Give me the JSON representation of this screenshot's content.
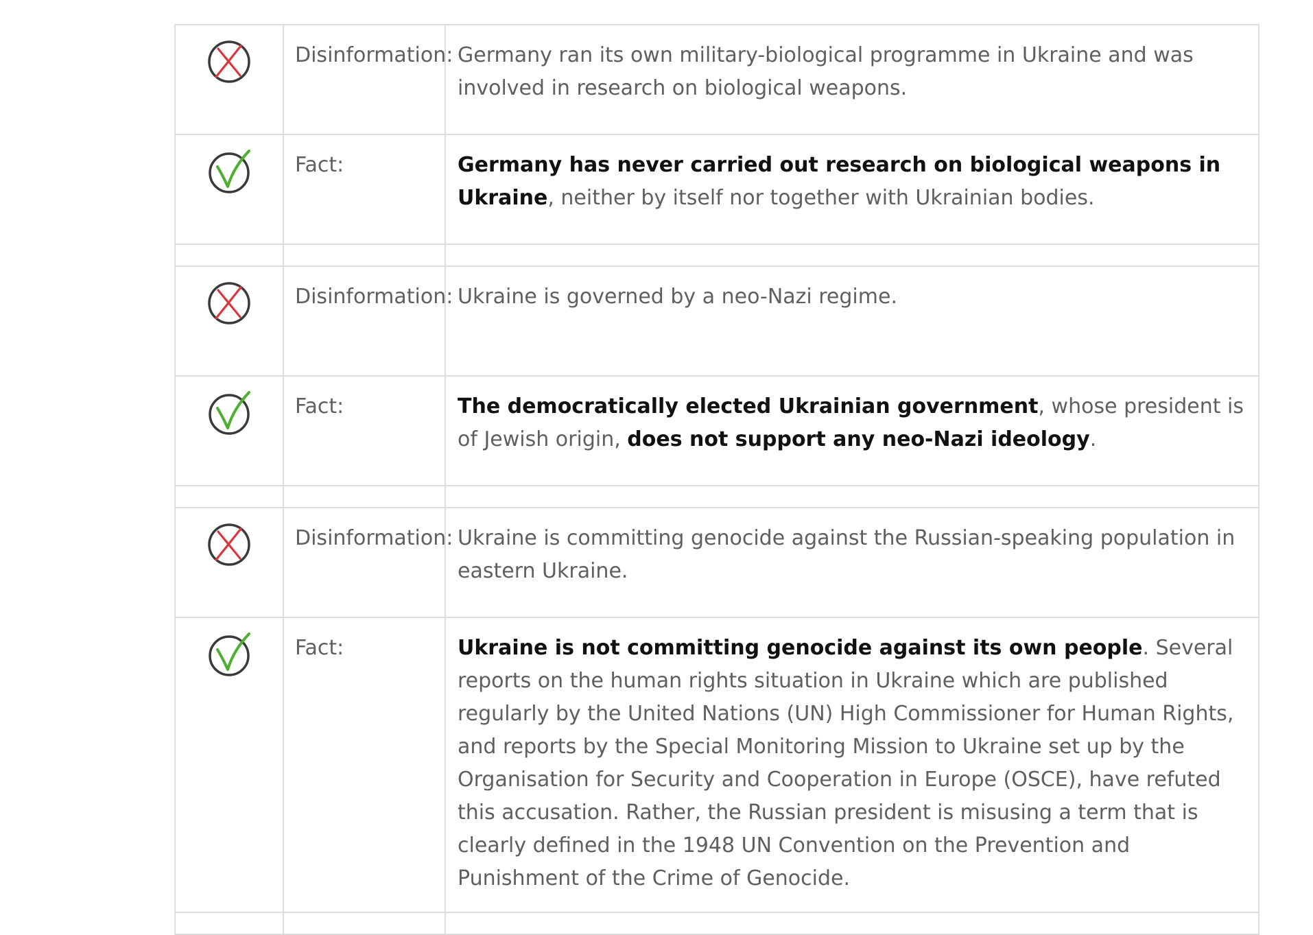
{
  "entries": [
    {
      "kind": "disinformation",
      "icon": "cross-circle-icon",
      "label": "Disinformation:",
      "segments": [
        {
          "text": "Germany ran its own military-biological programme in Ukraine and was involved in research on biological weapons.",
          "bold": false
        }
      ]
    },
    {
      "kind": "fact",
      "icon": "check-circle-icon",
      "label": "Fact:",
      "segments": [
        {
          "text": "Germany has never carried out research on biological weapons in Ukraine",
          "bold": true
        },
        {
          "text": ", neither by itself nor together with Ukrainian bodies.",
          "bold": false
        }
      ]
    },
    {
      "kind": "disinformation",
      "icon": "cross-circle-icon",
      "label": "Disinformation:",
      "segments": [
        {
          "text": "Ukraine is governed by a neo-Nazi regime.",
          "bold": false
        }
      ]
    },
    {
      "kind": "fact",
      "icon": "check-circle-icon",
      "label": "Fact:",
      "segments": [
        {
          "text": "The democratically elected Ukrainian government",
          "bold": true
        },
        {
          "text": ", whose president is of Jewish origin, ",
          "bold": false
        },
        {
          "text": "does not support any neo-Nazi ideology",
          "bold": true
        },
        {
          "text": ".",
          "bold": false
        }
      ]
    },
    {
      "kind": "disinformation",
      "icon": "cross-circle-icon",
      "label": "Disinformation:",
      "segments": [
        {
          "text": "Ukraine is committing genocide against the Russian-speaking population in eastern Ukraine.",
          "bold": false
        }
      ]
    },
    {
      "kind": "fact",
      "icon": "check-circle-icon",
      "label": "Fact:",
      "segments": [
        {
          "text": "Ukraine is not committing genocide against its own people",
          "bold": true
        },
        {
          "text": ". Several reports on the human rights situation in Ukraine which are published regularly by the United Nations (UN) High Commissioner for Human Rights, and reports by the Special Monitoring Mission to Ukraine set up by the Organisation for Security and Cooperation in Europe (OSCE), have refuted this accusation. Rather, the Russian president is misusing a term that is clearly defined in the 1948 UN Convention on the Prevention and Punishment of the Crime of Genocide.",
          "bold": false
        }
      ]
    }
  ],
  "colors": {
    "cross": "#d9363e",
    "check": "#4caf2f",
    "circle": "#3a3a3a",
    "border": "#dcdcdc",
    "body_text": "#5f5f5f",
    "bold_text": "#111111"
  }
}
